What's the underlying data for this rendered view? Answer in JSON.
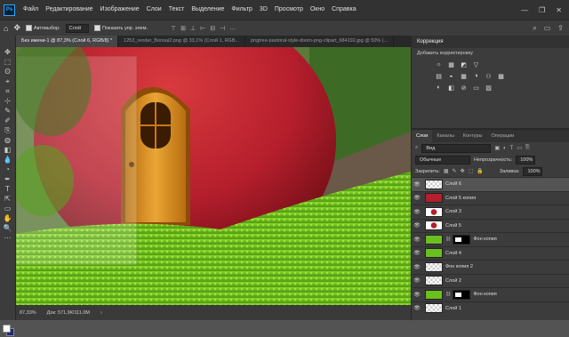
{
  "app": {
    "logo": "Ps"
  },
  "menu": [
    "Файл",
    "Редактирование",
    "Изображение",
    "Слои",
    "Текст",
    "Выделение",
    "Фильтр",
    "3D",
    "Просмотр",
    "Окно",
    "Справка"
  ],
  "window_controls": [
    "—",
    "❐",
    "✕"
  ],
  "options": {
    "autoselect_label": "Автовыбор:",
    "autoselect_value": "Слой",
    "show_controls_label": "Показать упр. элем."
  },
  "tabs": [
    {
      "label": "Без имени-1 @ 87,3% (Слой 6, RGB/8) *",
      "active": true
    },
    {
      "label": "1253_render_Bonsai2.png @ 33,1% (Слой 1, RGB...",
      "active": false
    },
    {
      "label": "pngtree-pastoral-style-doom-png-clipart_684192.jpg @ 50% (...",
      "active": false
    }
  ],
  "tools": [
    "✥",
    "⬚",
    "ʘ",
    "⌖",
    "⌗",
    "⊹",
    "✎",
    "✐",
    "⎘",
    "◍",
    "◧",
    "💧",
    "◔",
    "✒",
    "T",
    "⇱",
    "▭",
    "✋",
    "🔍",
    "⋯"
  ],
  "status": {
    "zoom": "87,33%",
    "doc": "Док: 571,9К/111,0М"
  },
  "adjustments": {
    "title": "Коррекция",
    "hint": "Добавить корректировку",
    "rows": [
      [
        "☼",
        "▦",
        "◩",
        "▽"
      ],
      [
        "▤",
        "◒",
        "▦",
        "◑",
        "⚇",
        "▩"
      ],
      [
        "◐",
        "◧",
        "⊘",
        "▭",
        "▨"
      ]
    ]
  },
  "layers_panel": {
    "tabs": [
      "Слои",
      "Каналы",
      "Контуры",
      "Операции"
    ],
    "filter": "Вид",
    "blend_mode": "Обычные",
    "opacity_label": "Непрозрачность:",
    "opacity_value": "100%",
    "lock_label": "Закрепить:",
    "fill_label": "Заливка:",
    "fill_value": "100%",
    "layers": [
      {
        "name": "Слой 6",
        "active": true,
        "thumb": "checker",
        "mask": false
      },
      {
        "name": "Слой 5 копия",
        "active": false,
        "thumb": "apple",
        "mask": false
      },
      {
        "name": "Слой 3",
        "active": false,
        "thumb": "dot",
        "mask": false
      },
      {
        "name": "Слой 5",
        "active": false,
        "thumb": "dot",
        "mask": false
      },
      {
        "name": "Фон копия",
        "active": false,
        "thumb": "grass",
        "mask": true
      },
      {
        "name": "Слой 4",
        "active": false,
        "thumb": "grass",
        "mask": false
      },
      {
        "name": "Фон копия 2",
        "active": false,
        "thumb": "checker",
        "mask": false
      },
      {
        "name": "Слой 2",
        "active": false,
        "thumb": "checker",
        "mask": false
      },
      {
        "name": "Фон копия",
        "active": false,
        "thumb": "grass",
        "mask": true
      },
      {
        "name": "Слой 1",
        "active": false,
        "thumb": "checker",
        "mask": false
      }
    ]
  },
  "colors": {
    "accent": "#31a8ff",
    "foreground": "#ffffff",
    "background": "#1a2a7a",
    "apple": "#b51e2c",
    "grass": "#6bbf1e"
  }
}
